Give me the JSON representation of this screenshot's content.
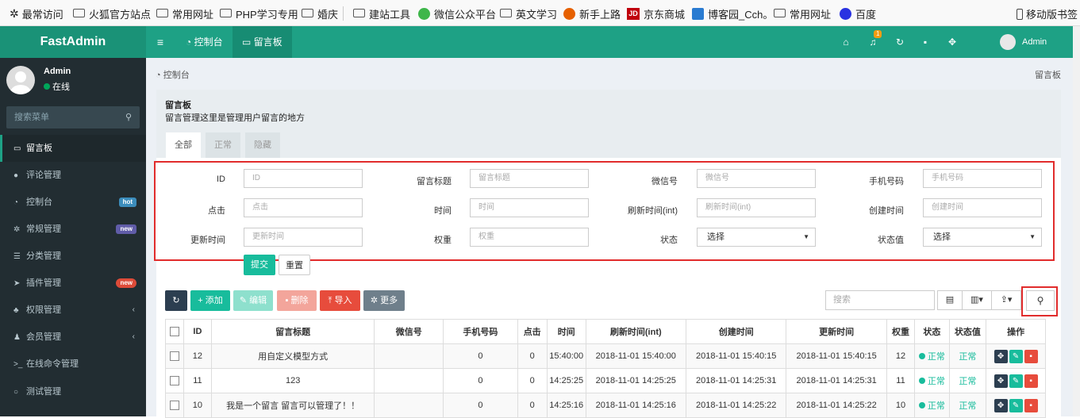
{
  "bookmarks": [
    {
      "label": "最常访问",
      "icon": "gear-icon"
    },
    {
      "label": "火狐官方站点",
      "icon": "folder-icon"
    },
    {
      "label": "常用网址",
      "icon": "folder-icon"
    },
    {
      "label": "PHP学习专用",
      "icon": "folder-icon"
    },
    {
      "label": "婚庆",
      "icon": "folder-icon"
    },
    {
      "label": "建站工具",
      "icon": "folder-icon"
    },
    {
      "label": "微信公众平台",
      "icon": "wechat-icon"
    },
    {
      "label": "英文学习",
      "icon": "folder-icon"
    },
    {
      "label": "新手上路",
      "icon": "firefox-icon"
    },
    {
      "label": "京东商城",
      "icon": "jd-icon"
    },
    {
      "label": "博客园_Cch。",
      "icon": "blog-icon"
    },
    {
      "label": "常用网址",
      "icon": "folder-icon"
    },
    {
      "label": "百度",
      "icon": "baidu-icon"
    },
    {
      "label": "移动版书签",
      "icon": "mobile-icon"
    }
  ],
  "header": {
    "logo": "FastAdmin",
    "nav": [
      "控制台",
      "留言板"
    ],
    "notification_count": "1",
    "user": "Admin",
    "icons": [
      "home-icon",
      "bell-icon",
      "refresh-icon",
      "trash-icon",
      "expand-icon"
    ]
  },
  "sidebar": {
    "user_name": "Admin",
    "status": "在线",
    "search_placeholder": "搜索菜单",
    "items": [
      {
        "label": "留言板",
        "active": true
      },
      {
        "label": "评论管理"
      },
      {
        "label": "控制台",
        "tag": "hot",
        "tag_color": "#3c8dbc"
      },
      {
        "label": "常规管理",
        "tag": "new",
        "tag_color": "#605ca8"
      },
      {
        "label": "分类管理"
      },
      {
        "label": "插件管理",
        "tag": "new",
        "tag_color": "#dd4b39"
      },
      {
        "label": "权限管理",
        "arrow": true
      },
      {
        "label": "会员管理",
        "arrow": true
      },
      {
        "label": "在线命令管理"
      },
      {
        "label": "测试管理"
      }
    ]
  },
  "breadcrumb": {
    "left": "控制台",
    "right": "留言板"
  },
  "panel": {
    "title": "留言板",
    "desc": "留言管理这里是管理用户留言的地方",
    "tabs": [
      "全部",
      "正常",
      "隐藏"
    ]
  },
  "filters": [
    {
      "label": "ID",
      "placeholder": "ID"
    },
    {
      "label": "留言标题",
      "placeholder": "留言标题"
    },
    {
      "label": "微信号",
      "placeholder": "微信号"
    },
    {
      "label": "手机号码",
      "placeholder": "手机号码"
    },
    {
      "label": "点击",
      "placeholder": "点击"
    },
    {
      "label": "时间",
      "placeholder": "时间"
    },
    {
      "label": "刷新时间(int)",
      "placeholder": "刷新时间(int)"
    },
    {
      "label": "创建时间",
      "placeholder": "创建时间"
    },
    {
      "label": "更新时间",
      "placeholder": "更新时间"
    },
    {
      "label": "权重",
      "placeholder": "权重"
    },
    {
      "label": "状态",
      "value": "选择"
    },
    {
      "label": "状态值",
      "value": "选择"
    }
  ],
  "form_buttons": {
    "submit": "提交",
    "reset": "重置"
  },
  "toolbar": {
    "add": "添加",
    "edit": "编辑",
    "delete": "删除",
    "import": "导入",
    "more": "更多",
    "search_placeholder": "搜索"
  },
  "table": {
    "columns": [
      "ID",
      "留言标题",
      "微信号",
      "手机号码",
      "点击",
      "时间",
      "刷新时间(int)",
      "创建时间",
      "更新时间",
      "权重",
      "状态",
      "状态值",
      "操作"
    ],
    "rows": [
      [
        "12",
        "用自定义模型方式",
        "",
        "0",
        "0",
        "15:40:00",
        "2018-11-01 15:40:00",
        "2018-11-01 15:40:15",
        "2018-11-01 15:40:15",
        "12",
        "正常",
        "正常"
      ],
      [
        "11",
        "123",
        "",
        "0",
        "0",
        "14:25:25",
        "2018-11-01 14:25:25",
        "2018-11-01 14:25:31",
        "2018-11-01 14:25:31",
        "11",
        "正常",
        "正常"
      ],
      [
        "10",
        "我是一个留言 留言可以管理了！！",
        "",
        "0",
        "0",
        "14:25:16",
        "2018-11-01 14:25:16",
        "2018-11-01 14:25:22",
        "2018-11-01 14:25:22",
        "10",
        "正常",
        "正常"
      ]
    ]
  }
}
